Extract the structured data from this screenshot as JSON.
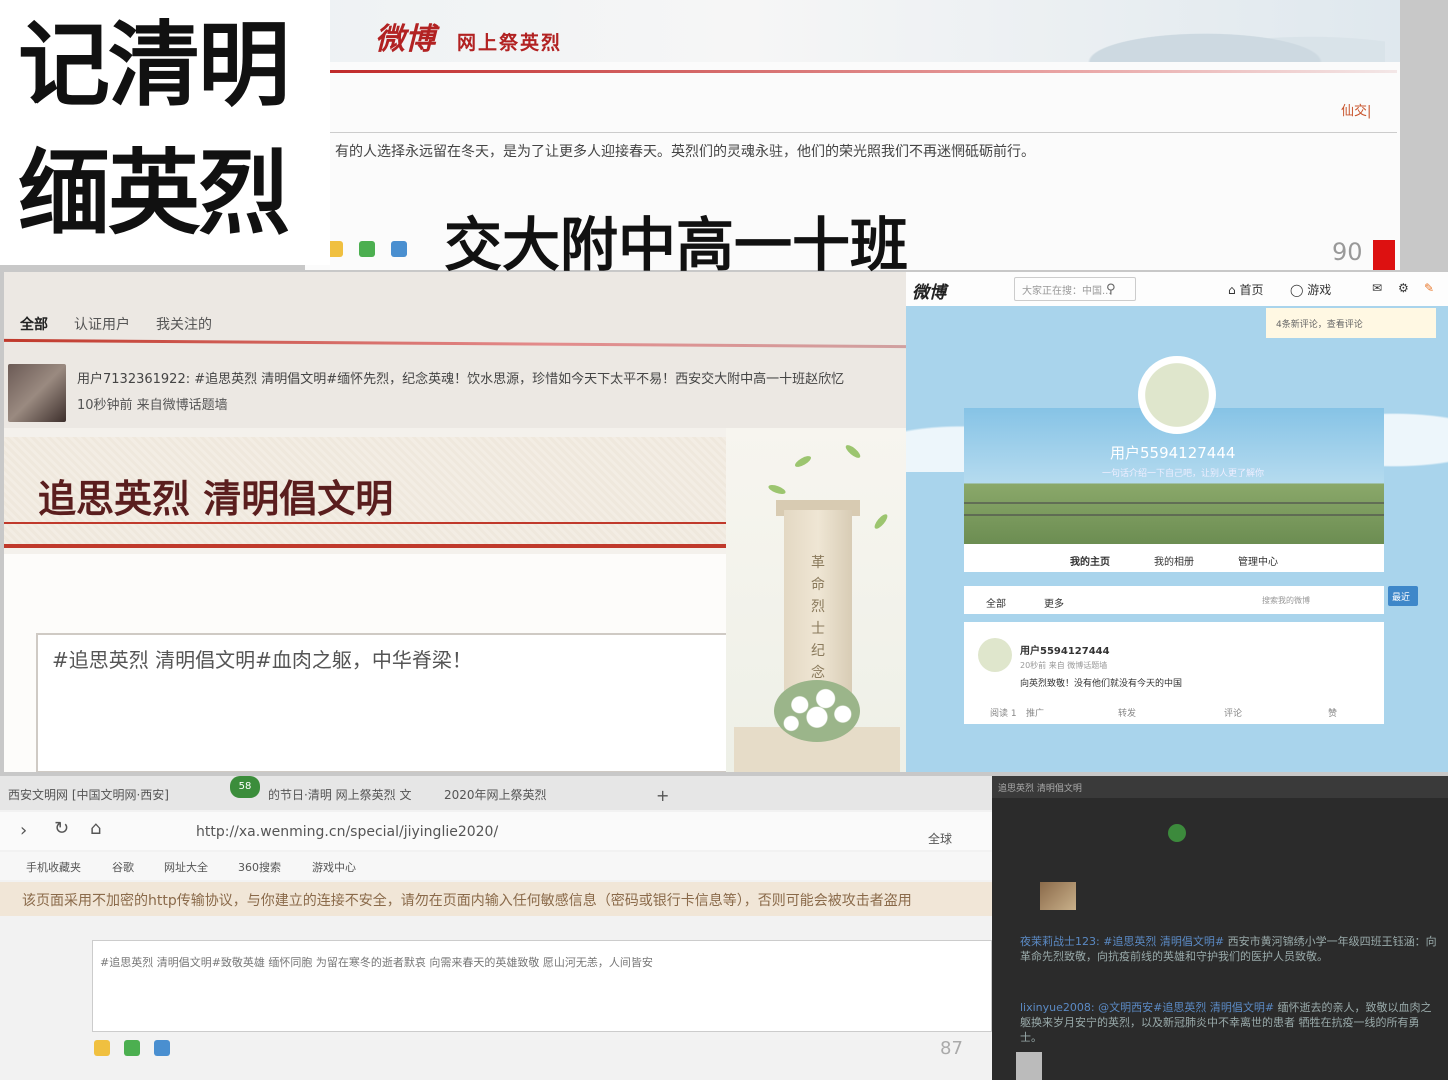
{
  "title": {
    "line1": "记清明",
    "line2": "缅英烈",
    "subtitle": "交大附中高一十班"
  },
  "top_post": {
    "logo": "微博",
    "banner_sub": "网上祭英烈",
    "weibo_link": "仙交|",
    "text": "有的人选择永远留在冬天，是为了让更多人迎接春天。英烈们的灵魂永驻，他们的荣光照我们不再迷惘砥砺前行。",
    "count": "90"
  },
  "mid_feed": {
    "tabs": [
      "全部",
      "认证用户",
      "我关注的"
    ],
    "post_text": "用户7132361922: #追思英烈 清明倡文明#缅怀先烈，纪念英魂！饮水思源，珍惜如今天下太平不易！西安交大附中高一十班赵欣忆",
    "post_meta": "10秒钟前 来自微博话题墙",
    "heading": "追思英烈   清明倡文明",
    "input_text": "#追思英烈 清明倡文明#血肉之躯，中华脊梁！",
    "monument_text": "革命烈士纪念碑"
  },
  "profile": {
    "logo": "微博",
    "search_placeholder": "大家正在搜：中国...",
    "nav": [
      "首页",
      "游戏"
    ],
    "notify": "4条新评论，查看评论",
    "username": "用户5594127444",
    "desc": "一句话介绍一下自己吧，让别人更了解你",
    "tabs": [
      "我的主页",
      "我的相册",
      "管理中心"
    ],
    "filter": [
      "全部",
      "更多"
    ],
    "filter_search": "搜索我的微博",
    "side_button": "最近",
    "feed_name": "用户5594127444",
    "feed_meta": "20秒前 来自 微博话题墙",
    "feed_text": "向英烈致敬！没有他们就没有今天的中国",
    "actions": [
      "阅读 1",
      "推广",
      "转发",
      "评论",
      "赞"
    ]
  },
  "browser": {
    "tabs": [
      "西安文明网 [中国文明网·西安]",
      "的节日·清明 网上祭英烈 文",
      "2020年网上祭英烈"
    ],
    "badge": "58",
    "url": "http://xa.wenming.cn/special/jiyinglie2020/",
    "search_hint": "全球",
    "bookmarks": [
      "手机收藏夹",
      "谷歌",
      "网址大全",
      "360搜索",
      "游戏中心"
    ],
    "warning": "该页面采用不加密的http传输协议，与你建立的连接不安全，请勿在页面内输入任何敏感信息（密码或银行卡信息等），否则可能会被攻击者盗用",
    "input_text": "#追思英烈 清明倡文明#致敬英雄 缅怀同胞 为留在寒冬的逝者默哀 向需来春天的英雄致敬 愿山河无恙，人间皆安",
    "count": "87"
  },
  "dark": {
    "header": "追思英烈   清明倡文明",
    "feed1_user": "夜茉莉战士123:",
    "feed1_tag": "#追思英烈 清明倡文明#",
    "feed1_text": "西安市黄河锦绣小学一年级四班王钰涵：向革命先烈致敬，向抗疫前线的英雄和守护我们的医护人员致敬。",
    "feed2_user": "lixinyue2008:",
    "feed2_tag": "@文明西安#追思英烈 清明倡文明#",
    "feed2_text": "缅怀逝去的亲人，致敬以血肉之躯换来岁月安宁的英烈，以及新冠肺炎中不幸离世的患者 牺牲在抗疫一线的所有勇士。"
  }
}
